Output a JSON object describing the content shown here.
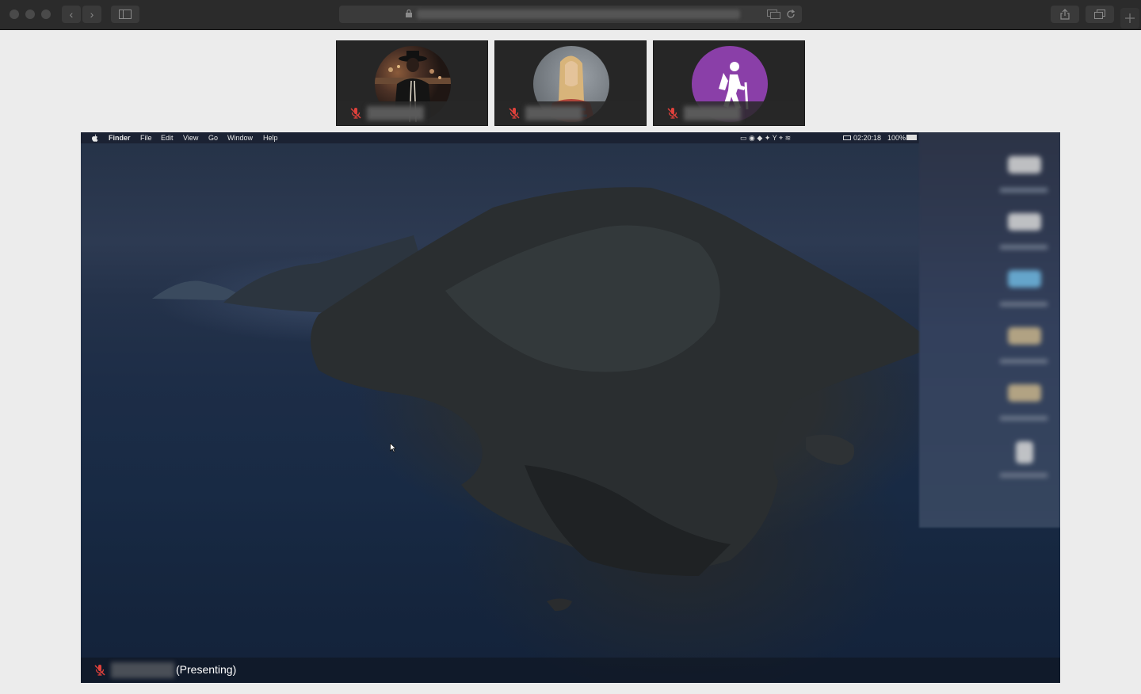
{
  "browser": {
    "back_glyph": "‹",
    "forward_glyph": "›",
    "sidebar_icon": "sidebar-icon",
    "address_masked": true,
    "share_icon": "share-icon",
    "tabs_icon": "tabs-icon"
  },
  "participants": [
    {
      "avatar": "photo-man-hat",
      "muted": true
    },
    {
      "avatar": "photo-woman-blonde",
      "muted": true
    },
    {
      "avatar": "hiker-icon",
      "color": "#8a3fa8",
      "muted": true
    }
  ],
  "shared_screen": {
    "menubar": {
      "apple": "",
      "items": [
        "Finder",
        "File",
        "Edit",
        "View",
        "Go",
        "Window",
        "Help"
      ],
      "clock": "02:20:18",
      "battery": "100%"
    },
    "presenter_label": "(Presenting)"
  },
  "colors": {
    "mic_muted": "#e0413b",
    "avatar_purple": "#8a3fa8"
  }
}
